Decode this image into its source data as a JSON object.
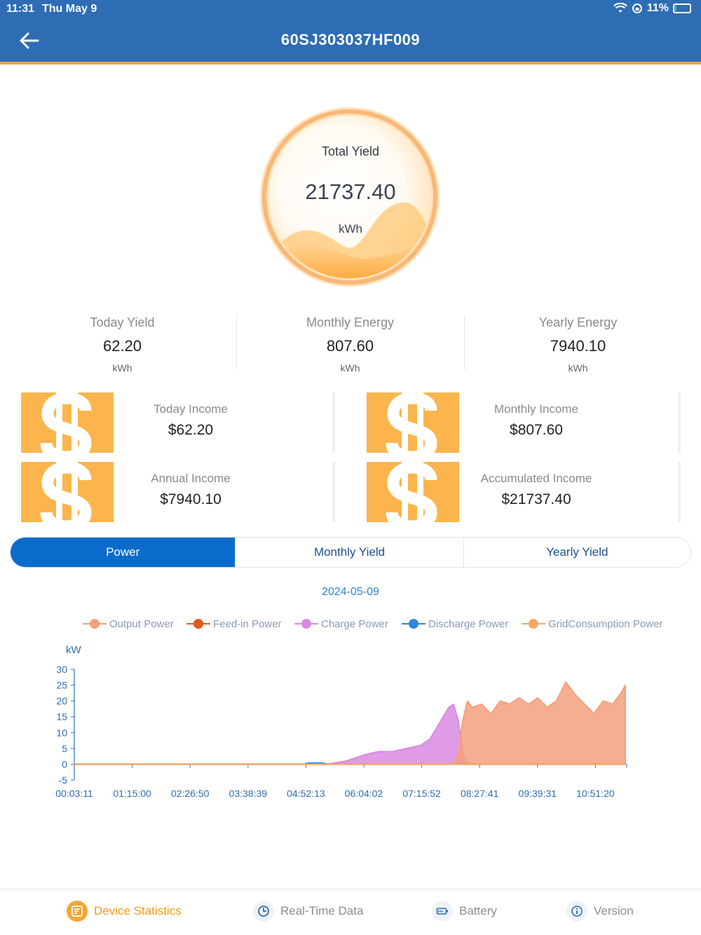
{
  "status_bar": {
    "time": "11:31",
    "date": "Thu May 9",
    "battery_percent": "11%",
    "battery_level": 0.11
  },
  "header": {
    "title": "60SJ303037HF009"
  },
  "total_yield": {
    "label": "Total Yield",
    "value": "21737.40",
    "unit": "kWh"
  },
  "stats": [
    {
      "label": "Today Yield",
      "value": "62.20",
      "unit": "kWh"
    },
    {
      "label": "Monthly Energy",
      "value": "807.60",
      "unit": "kWh"
    },
    {
      "label": "Yearly Energy",
      "value": "7940.10",
      "unit": "kWh"
    }
  ],
  "income": [
    {
      "label": "Today Income",
      "value": "$62.20"
    },
    {
      "label": "Monthly Income",
      "value": "$807.60"
    },
    {
      "label": "Annual Income",
      "value": "$7940.10"
    },
    {
      "label": "Accumulated Income",
      "value": "$21737.40"
    }
  ],
  "tabs": [
    {
      "label": "Power",
      "active": true
    },
    {
      "label": "Monthly Yield",
      "active": false
    },
    {
      "label": "Yearly Yield",
      "active": false
    }
  ],
  "chart_date": "2024-05-09",
  "colors": {
    "header": "#2e6db4",
    "accent": "#f39a1f",
    "tab_active": "#0b6bcb",
    "output_power": "#f5a07d",
    "feed_in_power": "#e05a1e",
    "charge_power": "#d98ae0",
    "discharge_power": "#2e86de",
    "grid_consumption_power": "#f0a86a"
  },
  "chart_data": {
    "type": "area",
    "ylabel": "kW",
    "ylim": [
      -5,
      30
    ],
    "yticks": [
      -5,
      0,
      5,
      10,
      15,
      20,
      25,
      30
    ],
    "xlim": [
      0,
      11.8
    ],
    "x_ticks": [
      "00:03:11",
      "01:15:00",
      "02:26:50",
      "03:38:39",
      "04:52:13",
      "06:04:02",
      "07:15:52",
      "08:27:41",
      "09:39:31",
      "10:51:20"
    ],
    "legend_position": "top",
    "series": [
      {
        "name": "Output Power",
        "color": "#f5a07d",
        "x": [
          0,
          8.1,
          8.2,
          8.3,
          8.4,
          8.5,
          8.7,
          8.9,
          9.1,
          9.3,
          9.5,
          9.7,
          9.9,
          10.1,
          10.3,
          10.5,
          10.7,
          10.9,
          11.1,
          11.3,
          11.5,
          11.7,
          11.9
        ],
        "y": [
          0,
          0,
          3,
          14,
          20,
          18,
          19,
          16,
          20,
          19,
          21,
          19,
          21,
          18,
          20,
          26,
          22,
          19,
          16,
          20,
          19,
          23,
          25
        ]
      },
      {
        "name": "Feed-in Power",
        "color": "#e05a1e",
        "x": [
          0,
          11.9
        ],
        "y": [
          0,
          0
        ]
      },
      {
        "name": "Charge Power",
        "color": "#d98ae0",
        "x": [
          0,
          5.4,
          5.8,
          6.2,
          6.5,
          6.8,
          7.1,
          7.4,
          7.6,
          7.8,
          8.0,
          8.1,
          8.2,
          8.3,
          8.4
        ],
        "y": [
          0,
          0,
          1,
          3,
          4,
          4,
          5,
          6,
          8,
          13,
          18,
          19,
          14,
          4,
          0
        ]
      },
      {
        "name": "Discharge Power",
        "color": "#2e86de",
        "x": [
          0,
          4.9,
          5.0,
          5.3,
          5.4,
          11.9
        ],
        "y": [
          0,
          0,
          0.4,
          0.4,
          0,
          0
        ]
      },
      {
        "name": "GridConsumption Power",
        "color": "#f0a86a",
        "x": [
          0,
          11.9
        ],
        "y": [
          0,
          0
        ]
      }
    ]
  },
  "bottom_nav": [
    {
      "label": "Device Statistics",
      "icon": "device-statistics-icon",
      "active": true
    },
    {
      "label": "Real-Time Data",
      "icon": "clock-icon",
      "active": false
    },
    {
      "label": "Battery",
      "icon": "battery-icon",
      "active": false
    },
    {
      "label": "Version",
      "icon": "info-icon",
      "active": false
    }
  ]
}
